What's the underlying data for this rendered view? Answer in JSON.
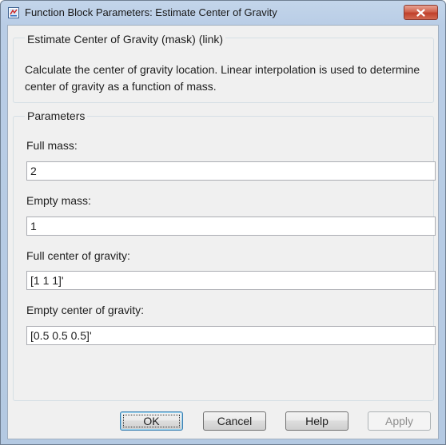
{
  "window": {
    "title": "Function Block Parameters: Estimate Center of Gravity"
  },
  "description_group": {
    "title": "Estimate Center of Gravity (mask) (link)",
    "text": "Calculate the center of gravity location.  Linear interpolation is used to determine center of gravity as a function of mass."
  },
  "parameters": {
    "title": "Parameters",
    "fields": [
      {
        "label": "Full mass:",
        "value": "2"
      },
      {
        "label": "Empty mass:",
        "value": "1"
      },
      {
        "label": "Full center of gravity:",
        "value": "[1 1 1]'"
      },
      {
        "label": "Empty center of gravity:",
        "value": "[0.5 0.5 0.5]'"
      }
    ]
  },
  "buttons": {
    "ok": "OK",
    "cancel": "Cancel",
    "help": "Help",
    "apply": "Apply"
  },
  "colors": {
    "title_bar": "#b9cde6",
    "close_button": "#c0402b",
    "dialog_bg": "#f0f0f0"
  }
}
